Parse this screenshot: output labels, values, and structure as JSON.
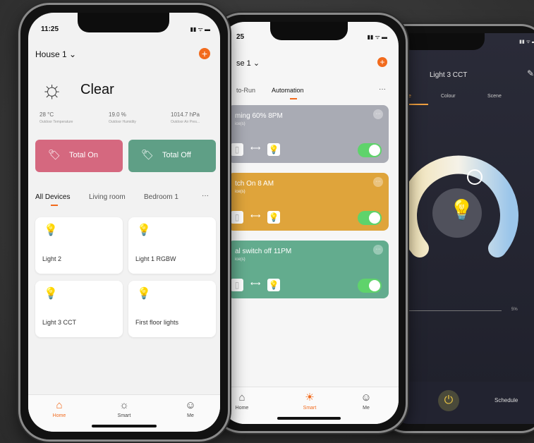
{
  "phone1": {
    "time": "11:25",
    "home_title": "House 1 ⌄",
    "weather": {
      "condition": "Clear",
      "icon": "sun-icon",
      "stats": [
        {
          "value": "28 °C",
          "label": "Outdoor Temperature"
        },
        {
          "value": "19.0 %",
          "label": "Outdoor Humidity"
        },
        {
          "value": "1014.7 hPa",
          "label": "Outdoor Air Pres..."
        }
      ]
    },
    "buttons": {
      "total_on": "Total On",
      "total_off": "Total Off"
    },
    "rooms": [
      "All Devices",
      "Living room",
      "Bedroom 1",
      "···"
    ],
    "devices": [
      "Light 2",
      "Light 1 RGBW",
      "Light 3 CCT",
      "First floor lights"
    ],
    "tabs": {
      "home": "Home",
      "smart": "Smart",
      "me": "Me"
    },
    "colors": {
      "accent": "#f26b1d",
      "total_on": "#d5687f",
      "total_off": "#5f9f86"
    }
  },
  "phone2": {
    "time": "25",
    "home_title": "se 1 ⌄",
    "tabs_top": [
      "to-Run",
      "Automation"
    ],
    "more": "···",
    "scenes": [
      {
        "title": "ming 60% 8PM",
        "sub": "ice(s)",
        "color": "#a9abb4"
      },
      {
        "title": "tch On 8 AM",
        "sub": "ice(s)",
        "color": "#dfa43b"
      },
      {
        "title": "al switch off 11PM",
        "sub": "ice(s)",
        "color": "#63ac8e"
      }
    ],
    "tabs": {
      "home": "Home",
      "smart": "Smart",
      "me": "Me"
    }
  },
  "phone3": {
    "title": "Light 3 CCT",
    "tabs": [
      "e",
      "Colour",
      "Scene"
    ],
    "brightness": "5%",
    "schedule": "Schedule"
  }
}
